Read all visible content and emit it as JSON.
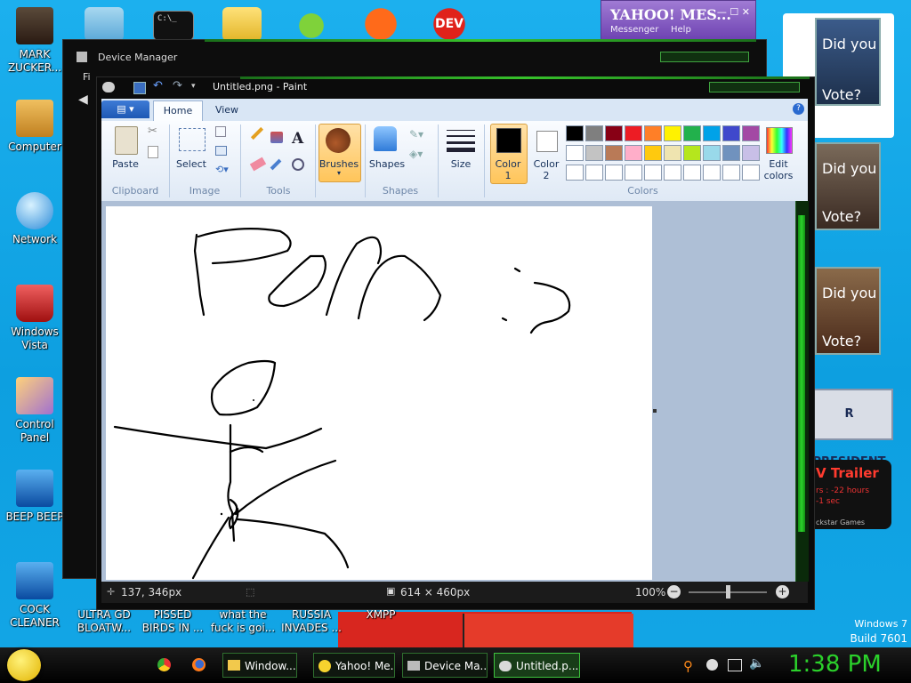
{
  "desktop": {
    "left_icons": [
      {
        "label": "MARK ZUCKER...",
        "icon": "person-icon"
      },
      {
        "label": "Computer",
        "icon": "computer-icon"
      },
      {
        "label": "Network",
        "icon": "network-icon"
      },
      {
        "label": "Windows Vista",
        "icon": "recycle-bin-icon"
      },
      {
        "label": "Control Panel",
        "icon": "control-panel-icon"
      },
      {
        "label": "BEEP BEEP",
        "icon": "media-icon"
      },
      {
        "label": "COCK CLEANER",
        "icon": "media-icon"
      }
    ],
    "bottom_icons": [
      {
        "label": "ULTRA GD BLOATW..."
      },
      {
        "label": "PISSED BIRDS IN ..."
      },
      {
        "label": "what the fuck is goi..."
      },
      {
        "label": "RUSSIA INVADES ..."
      },
      {
        "label": "XMPP"
      }
    ],
    "top_icon_texts": [
      "C:\\_",
      "DEV"
    ],
    "watermark": {
      "line1": "Windows 7",
      "line2": "Build 7601"
    },
    "wallpaper_posters": {
      "vote_text_a": "Did you",
      "vote_text_b": "Vote?",
      "president": "R PRESIDENT",
      "trailer": "V Trailer",
      "trailer_line1": "rs : -22 hours",
      "trailer_line2": "-1 sec",
      "trailer_brand": "ckstar Games"
    }
  },
  "yahoo_messenger": {
    "logo": "YAHOO! MES...",
    "menu_messenger": "Messenger",
    "menu_help": "Help"
  },
  "device_manager": {
    "title": "Device Manager",
    "menu_fragment": "Fi"
  },
  "paint": {
    "title": "Untitled.png - Paint",
    "tabs": [
      "Home",
      "View"
    ],
    "groups": {
      "clipboard": "Clipboard",
      "image": "Image",
      "tools": "Tools",
      "shapes": "Shapes",
      "colors": "Colors"
    },
    "buttons": {
      "paste": "Paste",
      "select": "Select",
      "brushes": "Brushes",
      "shapes": "Shapes",
      "size": "Size",
      "color1_a": "Color",
      "color1_b": "1",
      "color2_a": "Color",
      "color2_b": "2",
      "edit_colors_a": "Edit",
      "edit_colors_b": "colors"
    },
    "palette_row1": [
      "#000000",
      "#7f7f7f",
      "#880015",
      "#ed1c24",
      "#ff7f27",
      "#fff200",
      "#22b14c",
      "#00a2e8",
      "#3f48cc",
      "#a349a4"
    ],
    "palette_row2": [
      "#ffffff",
      "#c3c3c3",
      "#b97a57",
      "#ffaec9",
      "#ffc90e",
      "#efe4b0",
      "#b5e61d",
      "#99d9ea",
      "#7092be",
      "#c8bfe7"
    ],
    "color1": "#000000",
    "color2": "#ffffff",
    "status": {
      "cursor_pos": "137, 346px",
      "image_size": "614 × 460px",
      "zoom": "100%"
    }
  },
  "taskbar": {
    "buttons": [
      {
        "label": "Window...",
        "icon": "folder-icon"
      },
      {
        "label": "Yahoo! Me...",
        "icon": "smiley-icon"
      },
      {
        "label": "Device Ma...",
        "icon": "device-manager-icon"
      },
      {
        "label": "Untitled.p...",
        "icon": "paint-icon"
      }
    ],
    "clock": "1:38 PM"
  }
}
